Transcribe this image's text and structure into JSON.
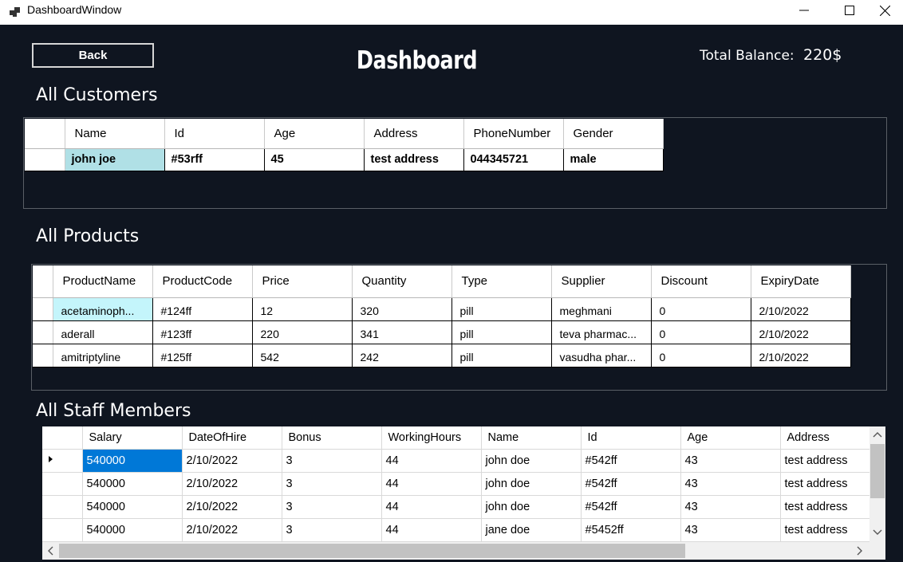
{
  "window": {
    "title": "DashboardWindow"
  },
  "header": {
    "back_label": "Back",
    "title": "Dashboard",
    "balance_label": "Total Balance:",
    "balance_value": "220$"
  },
  "customers": {
    "title": "All Customers",
    "columns": [
      "Name",
      "Id",
      "Age",
      "Address",
      "PhoneNumber",
      "Gender"
    ],
    "rows": [
      [
        "john joe",
        "#53rff",
        "45",
        "test address",
        "044345721",
        "male"
      ]
    ]
  },
  "products": {
    "title": "All Products",
    "columns": [
      "ProductName",
      "ProductCode",
      "Price",
      "Quantity",
      "Type",
      "Supplier",
      "Discount",
      "ExpiryDate"
    ],
    "rows": [
      [
        "acetaminoph...",
        "#124ff",
        "12",
        "320",
        "pill",
        "meghmani",
        "0",
        "2/10/2022"
      ],
      [
        "aderall",
        "#123ff",
        "220",
        "341",
        "pill",
        "teva pharmac...",
        "0",
        "2/10/2022"
      ],
      [
        "amitriptyline",
        "#125ff",
        "542",
        "242",
        "pill",
        "vasudha phar...",
        "0",
        "2/10/2022"
      ]
    ]
  },
  "staff": {
    "title": "All Staff Members",
    "columns": [
      "Salary",
      "DateOfHire",
      "Bonus",
      "WorkingHours",
      "Name",
      "Id",
      "Age",
      "Address"
    ],
    "rows": [
      [
        "540000",
        "2/10/2022",
        "3",
        "44",
        "john doe",
        "#542ff",
        "43",
        "test address"
      ],
      [
        "540000",
        "2/10/2022",
        "3",
        "44",
        "john doe",
        "#542ff",
        "43",
        "test address"
      ],
      [
        "540000",
        "2/10/2022",
        "3",
        "44",
        "john doe",
        "#542ff",
        "43",
        "test address"
      ],
      [
        "540000",
        "2/10/2022",
        "3",
        "44",
        "jane doe",
        "#5452ff",
        "43",
        "test address"
      ]
    ]
  },
  "colors": {
    "background": "#0f1520",
    "selection_blue": "#0078d7",
    "selection_cyan": "#b0e0e6"
  },
  "icons": {
    "app": "app-window-icon",
    "minimize": "minimize-icon",
    "maximize": "maximize-icon",
    "close": "close-icon",
    "row_pointer": "current-row-triangle-icon",
    "scroll_up": "chevron-up-icon",
    "scroll_down": "chevron-down-icon",
    "scroll_left": "chevron-left-icon",
    "scroll_right": "chevron-right-icon"
  }
}
